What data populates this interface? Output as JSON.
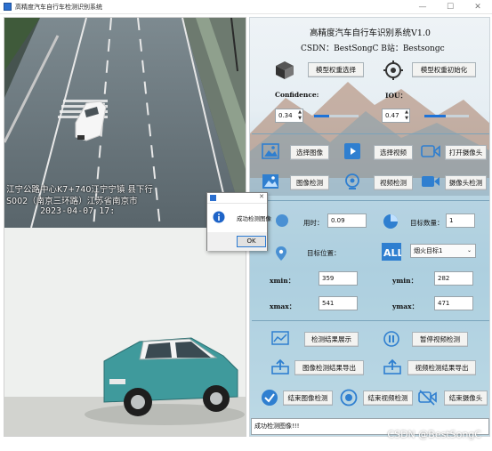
{
  "window": {
    "title": "高精度汽车自行车检测识别系统",
    "minimize": "—",
    "maximize": "☐",
    "close": "✕"
  },
  "video": {
    "overlay_line1": "江宁公路中心K7+740江宁宁镇 县下行",
    "overlay_line2": "S002（南京三环路）江苏省南京市",
    "overlay_time": "2023-04-07 17:"
  },
  "header": {
    "title": "高精度汽车自行车识别系统V1.0",
    "credits": "CSDN：BestSongC   B站：Bestsongc"
  },
  "model": {
    "select_label": "模型权重选择",
    "init_label": "模型权重初始化"
  },
  "params": {
    "confidence_label": "Confidence:",
    "confidence_value": "0.34",
    "confidence_level": 0.34,
    "iou_label": "IOU：",
    "iou_value": "0.47",
    "iou_level": 0.47
  },
  "actions": {
    "select_image": "选择图像",
    "select_video": "选择视频",
    "open_camera": "打开摄像头",
    "image_detect": "图像检测",
    "video_detect": "视频检测",
    "camera_detect": "摄像头检测"
  },
  "results": {
    "time_label": "用时：",
    "time_value": "0.09",
    "count_label": "目标数量：",
    "count_value": "1",
    "position_label": "目标位置：",
    "target_selected": "烟火目标1",
    "xmin_label": "xmin：",
    "xmin_value": "359",
    "ymin_label": "ymin：",
    "ymin_value": "282",
    "xmax_label": "xmax：",
    "xmax_value": "541",
    "ymax_label": "ymax：",
    "ymax_value": "471"
  },
  "bottom": {
    "show_results": "检测结果展示",
    "pause_video": "暂停视频检测",
    "export_image": "图像检测结果导出",
    "export_video": "视频检测结果导出",
    "end_image": "结束图像检测",
    "end_video": "结束视频检测",
    "end_camera": "结束摄像头"
  },
  "status": {
    "text": "成功检测图像!!!"
  },
  "dialog": {
    "title": "",
    "message": "成功检测图像",
    "ok_label": "OK"
  },
  "watermark": "CSDN @BestSongC",
  "colors": {
    "icon_blue": "#2f7fd0",
    "slider_blue": "#1e73d8",
    "car_teal": "#3f9a9c"
  }
}
